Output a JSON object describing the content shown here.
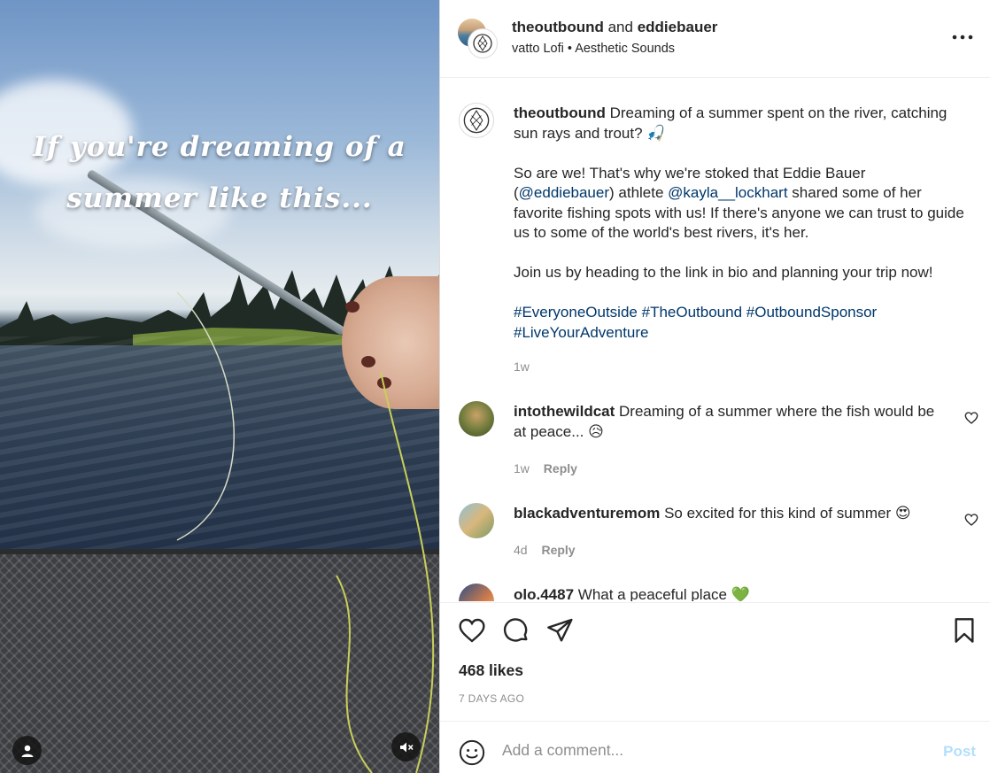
{
  "media": {
    "overlay_line1": "If you're dreaming of a",
    "overlay_line2": "summer like this...",
    "user_icon": "user-icon",
    "mute_icon": "speaker-muted-icon"
  },
  "header": {
    "user1": "theoutbound",
    "conjunction": "and",
    "user2": "eddiebauer",
    "audio_artist": "vatto Lofi",
    "audio_separator": "•",
    "audio_title": "Aesthetic Sounds"
  },
  "caption": {
    "username": "theoutbound",
    "line1": "Dreaming of a summer spent on the river, catching sun rays and trout?",
    "emoji1": "🎣",
    "p2_a": "So are we! That's why we're stoked that Eddie Bauer (",
    "p2_mention1": "@eddiebauer",
    "p2_b": ") athlete ",
    "p2_mention2": "@kayla__lockhart",
    "p2_c": " shared some of her favorite fishing spots with us! If there's anyone we can trust to guide us to some of the world's best rivers, it's her.",
    "p3": "Join us by heading to the link in bio and planning your trip now!",
    "hashtag1": "#EveryoneOutside",
    "hashtag2": "#TheOutbound",
    "hashtag3": "#OutboundSponsor",
    "hashtag4": "#LiveYourAdventure",
    "time": "1w"
  },
  "comments": [
    {
      "username": "intothewildcat",
      "text": "Dreaming of a summer where the fish would be at peace...",
      "emoji": "😥",
      "time": "1w",
      "reply": "Reply"
    },
    {
      "username": "blackadventuremom",
      "text": "So excited for this kind of summer",
      "emoji": "😍",
      "time": "4d",
      "reply": "Reply"
    },
    {
      "username": "olo.4487",
      "text": "What a peaceful place",
      "emoji": "💚"
    }
  ],
  "actions": {
    "likes": "468 likes",
    "date": "7 DAYS AGO"
  },
  "add_comment": {
    "placeholder": "Add a comment...",
    "post_label": "Post"
  },
  "colors": {
    "link": "#00376b",
    "muted": "#8e8e8e",
    "post_disabled": "#b2dffc"
  }
}
